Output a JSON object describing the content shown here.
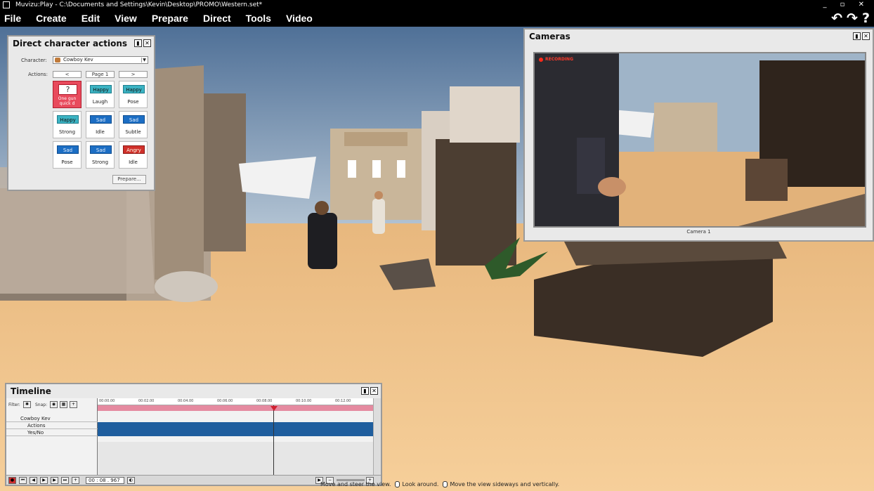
{
  "window": {
    "title": "Muvizu:Play - C:\\Documents and Settings\\Kevin\\Desktop\\PROMO\\Western.set*",
    "controls": "_ ▫ ✕"
  },
  "menu": [
    "File",
    "Create",
    "Edit",
    "View",
    "Prepare",
    "Direct",
    "Tools",
    "Video"
  ],
  "toolbar_icons": [
    "undo-icon",
    "redo-icon",
    "help-icon"
  ],
  "toolbar_glyphs": {
    "undo": "↶",
    "redo": "↷",
    "help": "?"
  },
  "dca": {
    "title": "Direct character actions",
    "character_label": "Character:",
    "character_value": "Cowboy Kev",
    "actions_label": "Actions:",
    "prev": "<",
    "page": "Page 1",
    "next": ">",
    "prepare": "Prepare...",
    "buttons": [
      {
        "tag": "?",
        "label": "One gun quick d",
        "mood": "active"
      },
      {
        "tag": "Happy",
        "label": "Laugh",
        "mood": "happy"
      },
      {
        "tag": "Happy",
        "label": "Pose",
        "mood": "happy"
      },
      {
        "tag": "Happy",
        "label": "Strong",
        "mood": "happy"
      },
      {
        "tag": "Sad",
        "label": "Idle",
        "mood": "sad"
      },
      {
        "tag": "Sad",
        "label": "Subtle",
        "mood": "sad"
      },
      {
        "tag": "Sad",
        "label": "Pose",
        "mood": "sad"
      },
      {
        "tag": "Sad",
        "label": "Strong",
        "mood": "sad"
      },
      {
        "tag": "Angry",
        "label": "Idle",
        "mood": "angry"
      }
    ]
  },
  "cameras": {
    "title": "Cameras",
    "recording": "RECORDING",
    "camera_label": "Camera 1"
  },
  "timeline": {
    "title": "Timeline",
    "filter_label": "Filter:",
    "snap_label": "Snap:",
    "ticks": [
      "00:00.00",
      "00:02.00",
      "00:04.00",
      "00:06.00",
      "00:08.00",
      "00:10.00",
      "00:12.00"
    ],
    "rows": [
      "Cowboy Kev",
      "Actions",
      "Yes/No"
    ],
    "time": "00 : 08 . 967",
    "playhead_fraction": 0.63
  },
  "hints": {
    "h1": "Move and steer the view.",
    "h2": "Look around.",
    "h3": "Move the view sideways and vertically."
  },
  "colors": {
    "sky": "#6f8fb0",
    "sand": "#f2c68c",
    "happy": "#3bb3c3",
    "sad": "#1c6ec4",
    "angry": "#d0302a",
    "track": "#1f5e9e"
  }
}
